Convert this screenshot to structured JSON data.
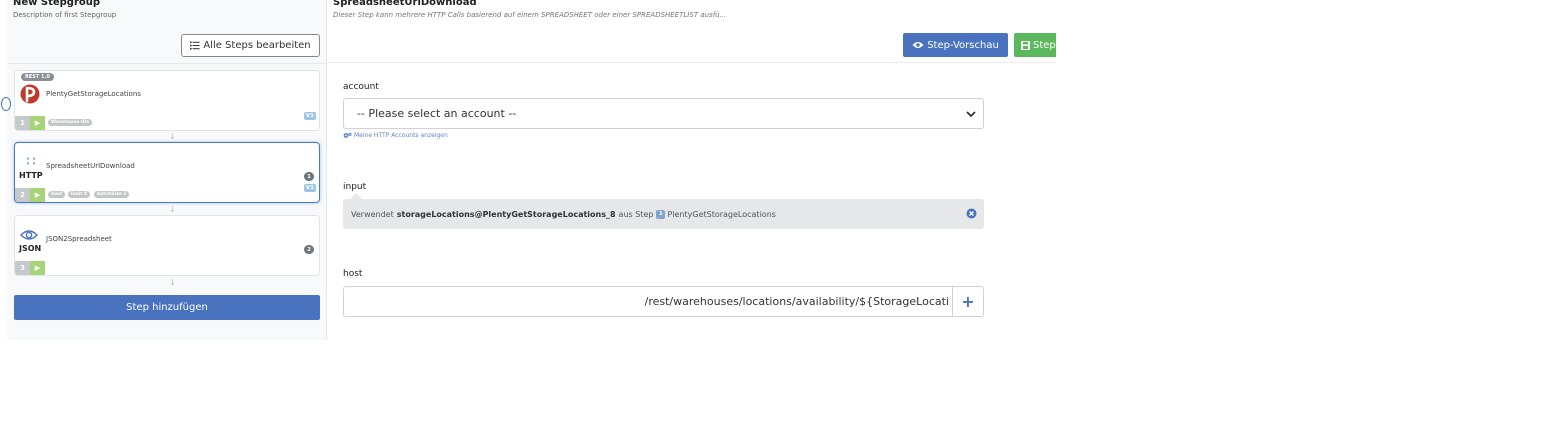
{
  "stepgroup": {
    "title": "New Stepgroup",
    "description": "Description of first Stepgroup",
    "edit_all_label": "Alle Steps bearbeiten",
    "add_step_label": "Step hinzufügen"
  },
  "steps": [
    {
      "number": "1",
      "name": "PlentyGetStorageLocations",
      "type_badge": "REST 1.0",
      "icon": "plenty-logo-icon",
      "version": "V1",
      "tags": [
        "Warehouse IDs"
      ]
    },
    {
      "number": "2",
      "name": "SpreadsheetUrlDownload",
      "type_label": "HTTP",
      "icon": "http-icon",
      "version": "V1",
      "count": "1",
      "tags": [
        "host",
        "limit 5",
        "batchSize 1"
      ]
    },
    {
      "number": "3",
      "name": "JSON2Spreadsheet",
      "type_label": "JSON",
      "icon": "eye-icon",
      "count": "2",
      "tags": []
    }
  ],
  "detail": {
    "title": "SpreadsheetUrlDownload",
    "description": "Dieser Step kann mehrere HTTP Calls basierend auf einem SPREADSHEET oder einer SPREADSHEETLIST ausfü...",
    "preview_label": "Step-Vorschau",
    "save_label": "Step",
    "account": {
      "label": "account",
      "selected": "-- Please select an account --",
      "link_label": "Meine HTTP Accounts anzeigen"
    },
    "input": {
      "label": "input",
      "prefix": "Verwendet",
      "variable": "storageLocations@PlentyGetStorageLocations_8",
      "middle": "aus Step",
      "step_number": "1",
      "step_name": "PlentyGetStorageLocations"
    },
    "host": {
      "label": "host",
      "value": "/rest/warehouses/locations/availability/${StorageLocati",
      "add_symbol": "+"
    }
  },
  "colors": {
    "primary": "#4a73bf",
    "success": "#5cb85c",
    "play": "#a6d477",
    "input_bg": "#e6e7e8"
  }
}
